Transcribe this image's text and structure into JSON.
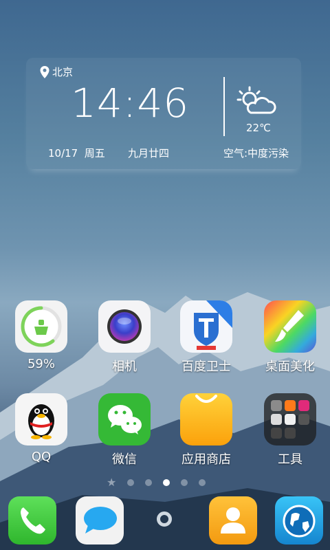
{
  "widget": {
    "location": "北京",
    "time": "14:46",
    "date": "10/17",
    "weekday": "周五",
    "lunar": "九月廿四",
    "temperature": "22℃",
    "air_quality": "空气:中度污染"
  },
  "apps_row1": [
    {
      "label": "59%",
      "icon": "cleaner-icon"
    },
    {
      "label": "相机",
      "icon": "camera-icon"
    },
    {
      "label": "百度卫士",
      "icon": "baidu-guard-icon"
    },
    {
      "label": "桌面美化",
      "icon": "theme-brush-icon"
    }
  ],
  "apps_row2": [
    {
      "label": "QQ",
      "icon": "qq-penguin-icon"
    },
    {
      "label": "微信",
      "icon": "wechat-icon"
    },
    {
      "label": "应用商店",
      "icon": "app-store-icon"
    },
    {
      "label": "工具",
      "icon": "tools-folder-icon"
    }
  ],
  "cleaner_level": 0.59,
  "pager": {
    "pages": 5,
    "active": 3
  },
  "dock": [
    {
      "icon": "phone-icon"
    },
    {
      "icon": "messages-icon"
    },
    {
      "icon": "home-circle-icon"
    },
    {
      "icon": "contacts-icon"
    },
    {
      "icon": "browser-globe-icon"
    }
  ],
  "colors": {
    "phone": "#3cc63a",
    "wechat": "#35b936",
    "store": "#fdb913",
    "contacts": "#f7a21a",
    "browser": "#1f9fe0"
  }
}
